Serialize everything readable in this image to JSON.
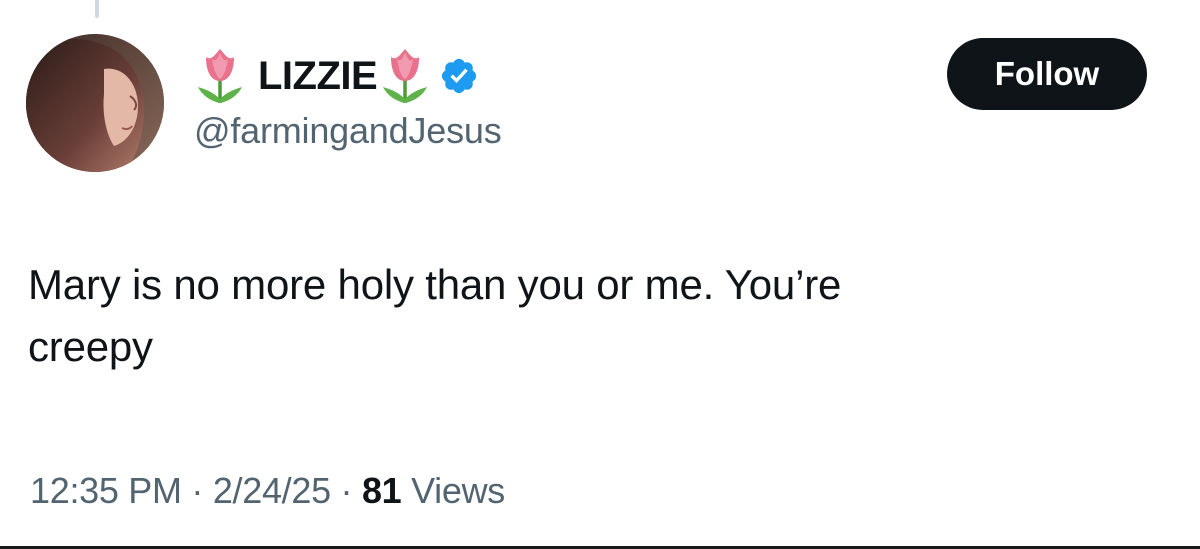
{
  "author": {
    "display_name": "LIZZIE",
    "handle": "@farmingandJesus",
    "verified": true,
    "name_emoji": "tulip-icon"
  },
  "follow_button": {
    "label": "Follow"
  },
  "tweet": {
    "text": "Mary is no more holy than you or me. You’re\ncreepy"
  },
  "meta": {
    "time": "12:35 PM",
    "separator": "·",
    "date": "2/24/25",
    "views_count": "81",
    "views_label": "Views"
  },
  "colors": {
    "text_primary": "#0f1419",
    "text_secondary": "#536471",
    "verified_blue": "#1d9bf0",
    "follow_bg": "#0f1419"
  }
}
